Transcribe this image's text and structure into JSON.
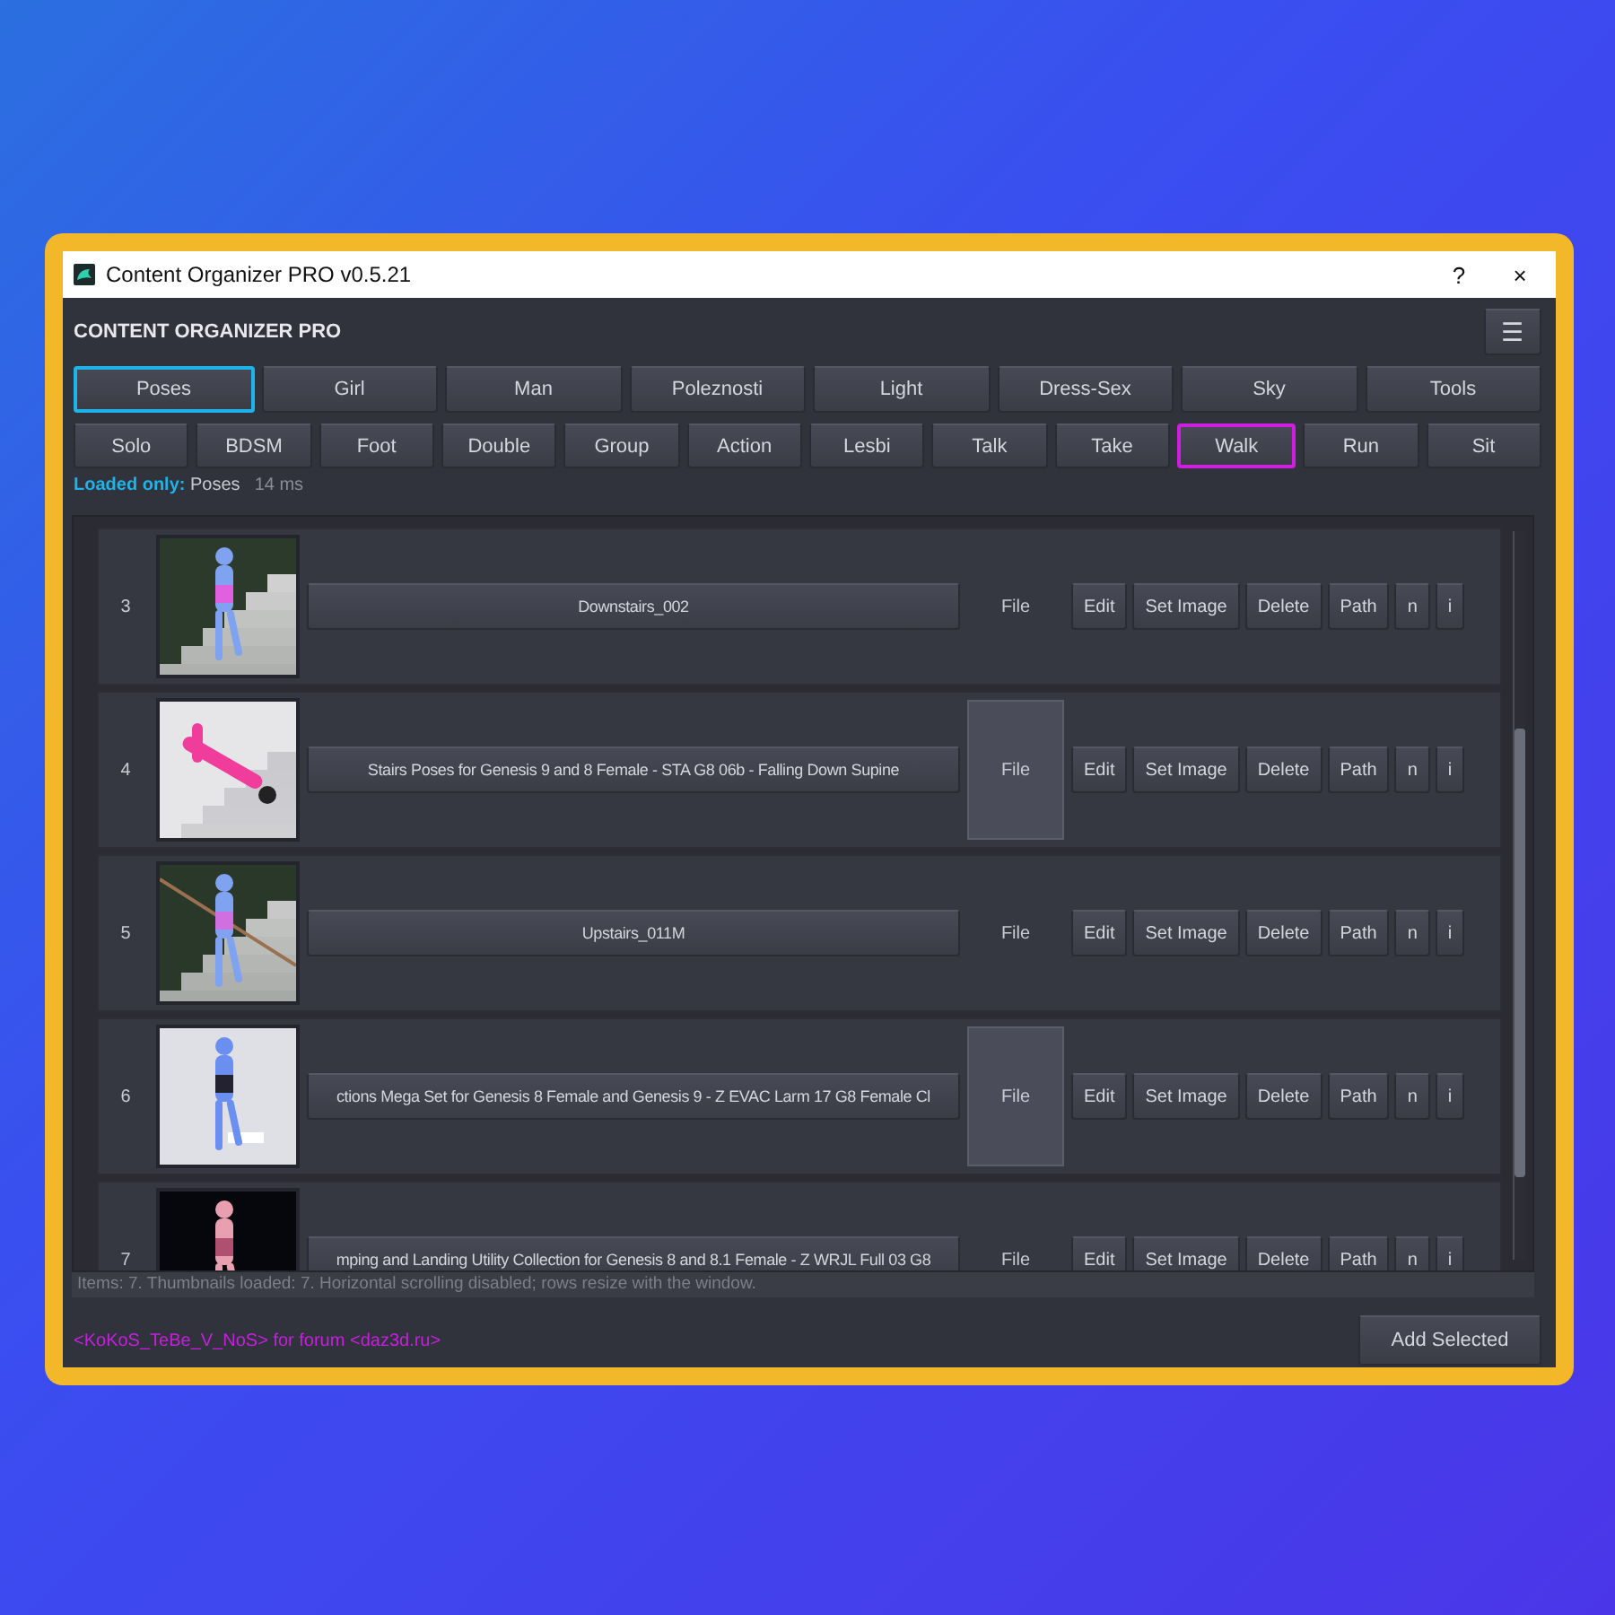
{
  "window": {
    "title": "Content Organizer PRO v0.5.21",
    "help": "?",
    "close": "×"
  },
  "header": {
    "title": "CONTENT ORGANIZER PRO",
    "menu": "☰"
  },
  "categories": [
    {
      "label": "Poses",
      "selected": true
    },
    {
      "label": "Girl",
      "selected": false
    },
    {
      "label": "Man",
      "selected": false
    },
    {
      "label": "Poleznosti",
      "selected": false
    },
    {
      "label": "Light",
      "selected": false
    },
    {
      "label": "Dress-Sex",
      "selected": false
    },
    {
      "label": "Sky",
      "selected": false
    },
    {
      "label": "Tools",
      "selected": false
    }
  ],
  "subcategories": [
    {
      "label": "Solo",
      "selected": false
    },
    {
      "label": "BDSM",
      "selected": false
    },
    {
      "label": "Foot",
      "selected": false
    },
    {
      "label": "Double",
      "selected": false
    },
    {
      "label": "Group",
      "selected": false
    },
    {
      "label": "Action",
      "selected": false
    },
    {
      "label": "Lesbi",
      "selected": false
    },
    {
      "label": "Talk",
      "selected": false
    },
    {
      "label": "Take",
      "selected": false
    },
    {
      "label": "Walk",
      "selected": true
    },
    {
      "label": "Run",
      "selected": false
    },
    {
      "label": "Sit",
      "selected": false
    }
  ],
  "loaded": {
    "label": "Loaded only:",
    "value": "Poses",
    "time": "14 ms"
  },
  "rows": [
    {
      "number": "3",
      "name": "Downstairs_002",
      "file": "File",
      "file_shaded": false,
      "buttons": [
        "Edit",
        "Set Image",
        "Delete",
        "Path",
        "n",
        "i"
      ]
    },
    {
      "number": "4",
      "name": "Stairs Poses for Genesis 9 and 8 Female - STA G8 06b - Falling Down Supine",
      "file": "File",
      "file_shaded": true,
      "buttons": [
        "Edit",
        "Set Image",
        "Delete",
        "Path",
        "n",
        "i"
      ]
    },
    {
      "number": "5",
      "name": "Upstairs_011M",
      "file": "File",
      "file_shaded": false,
      "buttons": [
        "Edit",
        "Set Image",
        "Delete",
        "Path",
        "n",
        "i"
      ]
    },
    {
      "number": "6",
      "name": "ctions Mega Set for Genesis 8 Female and Genesis 9 - Z EVAC Larm 17 G8 Female Cl",
      "file": "File",
      "file_shaded": true,
      "buttons": [
        "Edit",
        "Set Image",
        "Delete",
        "Path",
        "n",
        "i"
      ]
    },
    {
      "number": "7",
      "name": "mping and Landing Utility Collection for Genesis 8 and 8.1 Female - Z WRJL Full 03 G8",
      "file": "File",
      "file_shaded": false,
      "buttons": [
        "Edit",
        "Set Image",
        "Delete",
        "Path",
        "n",
        "i"
      ]
    }
  ],
  "status_bar": "Items: 7. Thumbnails loaded: 7. Horizontal scrolling disabled; rows resize with the window.",
  "footer": {
    "credit": "<KoKoS_TeBe_V_NoS> for forum <daz3d.ru>",
    "button": "Add Selected"
  }
}
